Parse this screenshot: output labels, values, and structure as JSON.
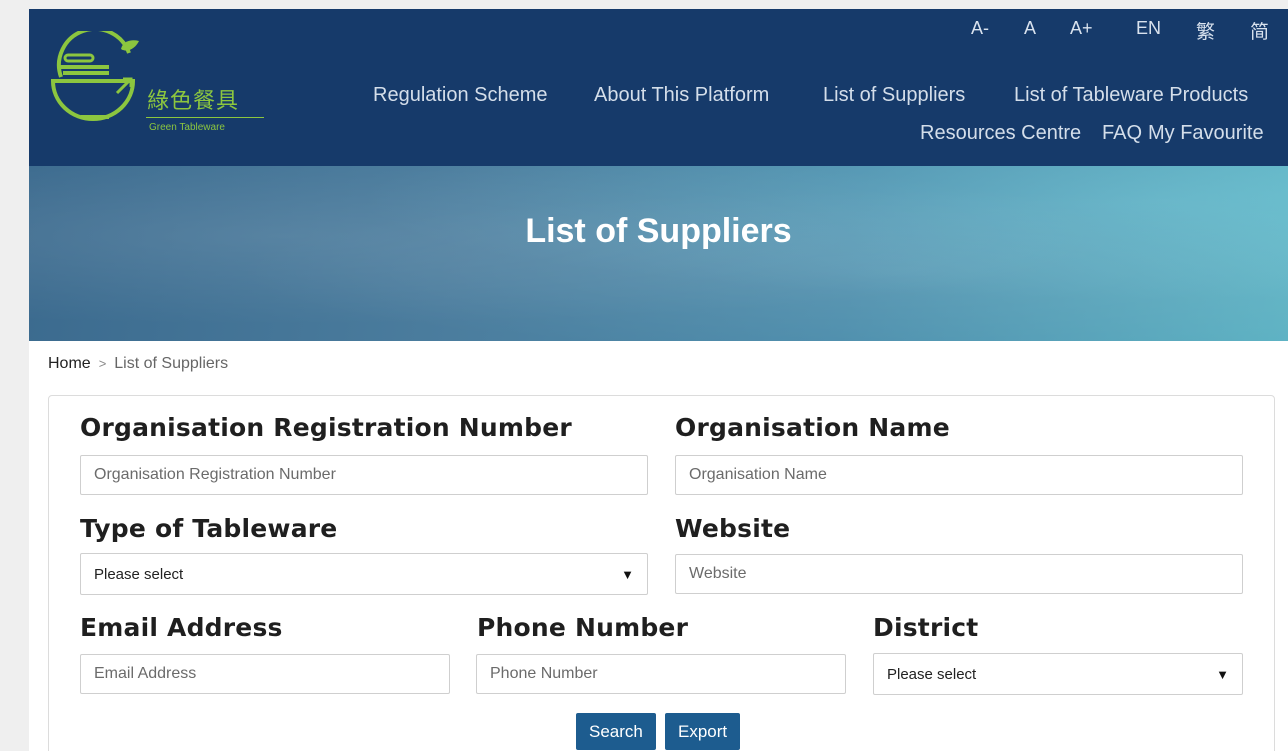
{
  "brand": {
    "name_cn": "綠色餐具",
    "name_en": "Green Tableware",
    "primary_color": "#163a6a",
    "accent_color": "#8cc63f",
    "button_color": "#1d5c8f"
  },
  "utility": {
    "font_decrease": "A-",
    "font_normal": "A",
    "font_increase": "A+",
    "lang_en": "EN",
    "lang_tc": "繁",
    "lang_sc": "简"
  },
  "nav": {
    "regulation": "Regulation Scheme",
    "about": "About This Platform",
    "suppliers": "List of Suppliers",
    "products": "List of Tableware Products",
    "resources": "Resources Centre",
    "faq": "FAQ",
    "favourite": "My Favourite"
  },
  "banner": {
    "title": "List of Suppliers"
  },
  "breadcrumb": {
    "home": "Home",
    "separator": ">",
    "current": "List of Suppliers"
  },
  "form": {
    "reg_no": {
      "label": "Organisation Registration Number",
      "placeholder": "Organisation Registration Number"
    },
    "org_name": {
      "label": "Organisation Name",
      "placeholder": "Organisation Name"
    },
    "tableware_type": {
      "label": "Type of Tableware",
      "value": "Please select"
    },
    "website": {
      "label": "Website",
      "placeholder": "Website"
    },
    "email": {
      "label": "Email Address",
      "placeholder": "Email Address"
    },
    "phone": {
      "label": "Phone Number",
      "placeholder": "Phone Number"
    },
    "district": {
      "label": "District",
      "value": "Please select"
    },
    "search_label": "Search",
    "export_label": "Export"
  }
}
